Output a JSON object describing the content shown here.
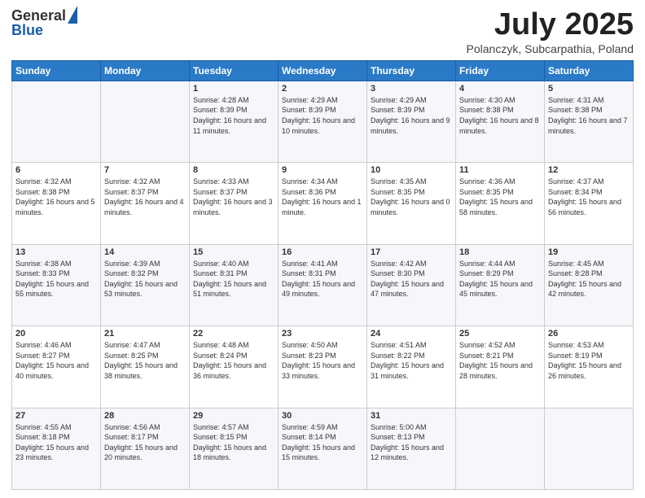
{
  "logo": {
    "general": "General",
    "blue": "Blue"
  },
  "header": {
    "month": "July 2025",
    "location": "Polanczyk, Subcarpathia, Poland"
  },
  "weekdays": [
    "Sunday",
    "Monday",
    "Tuesday",
    "Wednesday",
    "Thursday",
    "Friday",
    "Saturday"
  ],
  "weeks": [
    [
      {
        "day": "",
        "info": ""
      },
      {
        "day": "",
        "info": ""
      },
      {
        "day": "1",
        "info": "Sunrise: 4:28 AM\nSunset: 8:39 PM\nDaylight: 16 hours and 11 minutes."
      },
      {
        "day": "2",
        "info": "Sunrise: 4:29 AM\nSunset: 8:39 PM\nDaylight: 16 hours and 10 minutes."
      },
      {
        "day": "3",
        "info": "Sunrise: 4:29 AM\nSunset: 8:39 PM\nDaylight: 16 hours and 9 minutes."
      },
      {
        "day": "4",
        "info": "Sunrise: 4:30 AM\nSunset: 8:38 PM\nDaylight: 16 hours and 8 minutes."
      },
      {
        "day": "5",
        "info": "Sunrise: 4:31 AM\nSunset: 8:38 PM\nDaylight: 16 hours and 7 minutes."
      }
    ],
    [
      {
        "day": "6",
        "info": "Sunrise: 4:32 AM\nSunset: 8:38 PM\nDaylight: 16 hours and 5 minutes."
      },
      {
        "day": "7",
        "info": "Sunrise: 4:32 AM\nSunset: 8:37 PM\nDaylight: 16 hours and 4 minutes."
      },
      {
        "day": "8",
        "info": "Sunrise: 4:33 AM\nSunset: 8:37 PM\nDaylight: 16 hours and 3 minutes."
      },
      {
        "day": "9",
        "info": "Sunrise: 4:34 AM\nSunset: 8:36 PM\nDaylight: 16 hours and 1 minute."
      },
      {
        "day": "10",
        "info": "Sunrise: 4:35 AM\nSunset: 8:35 PM\nDaylight: 16 hours and 0 minutes."
      },
      {
        "day": "11",
        "info": "Sunrise: 4:36 AM\nSunset: 8:35 PM\nDaylight: 15 hours and 58 minutes."
      },
      {
        "day": "12",
        "info": "Sunrise: 4:37 AM\nSunset: 8:34 PM\nDaylight: 15 hours and 56 minutes."
      }
    ],
    [
      {
        "day": "13",
        "info": "Sunrise: 4:38 AM\nSunset: 8:33 PM\nDaylight: 15 hours and 55 minutes."
      },
      {
        "day": "14",
        "info": "Sunrise: 4:39 AM\nSunset: 8:32 PM\nDaylight: 15 hours and 53 minutes."
      },
      {
        "day": "15",
        "info": "Sunrise: 4:40 AM\nSunset: 8:31 PM\nDaylight: 15 hours and 51 minutes."
      },
      {
        "day": "16",
        "info": "Sunrise: 4:41 AM\nSunset: 8:31 PM\nDaylight: 15 hours and 49 minutes."
      },
      {
        "day": "17",
        "info": "Sunrise: 4:42 AM\nSunset: 8:30 PM\nDaylight: 15 hours and 47 minutes."
      },
      {
        "day": "18",
        "info": "Sunrise: 4:44 AM\nSunset: 8:29 PM\nDaylight: 15 hours and 45 minutes."
      },
      {
        "day": "19",
        "info": "Sunrise: 4:45 AM\nSunset: 8:28 PM\nDaylight: 15 hours and 42 minutes."
      }
    ],
    [
      {
        "day": "20",
        "info": "Sunrise: 4:46 AM\nSunset: 8:27 PM\nDaylight: 15 hours and 40 minutes."
      },
      {
        "day": "21",
        "info": "Sunrise: 4:47 AM\nSunset: 8:25 PM\nDaylight: 15 hours and 38 minutes."
      },
      {
        "day": "22",
        "info": "Sunrise: 4:48 AM\nSunset: 8:24 PM\nDaylight: 15 hours and 36 minutes."
      },
      {
        "day": "23",
        "info": "Sunrise: 4:50 AM\nSunset: 8:23 PM\nDaylight: 15 hours and 33 minutes."
      },
      {
        "day": "24",
        "info": "Sunrise: 4:51 AM\nSunset: 8:22 PM\nDaylight: 15 hours and 31 minutes."
      },
      {
        "day": "25",
        "info": "Sunrise: 4:52 AM\nSunset: 8:21 PM\nDaylight: 15 hours and 28 minutes."
      },
      {
        "day": "26",
        "info": "Sunrise: 4:53 AM\nSunset: 8:19 PM\nDaylight: 15 hours and 26 minutes."
      }
    ],
    [
      {
        "day": "27",
        "info": "Sunrise: 4:55 AM\nSunset: 8:18 PM\nDaylight: 15 hours and 23 minutes."
      },
      {
        "day": "28",
        "info": "Sunrise: 4:56 AM\nSunset: 8:17 PM\nDaylight: 15 hours and 20 minutes."
      },
      {
        "day": "29",
        "info": "Sunrise: 4:57 AM\nSunset: 8:15 PM\nDaylight: 15 hours and 18 minutes."
      },
      {
        "day": "30",
        "info": "Sunrise: 4:59 AM\nSunset: 8:14 PM\nDaylight: 15 hours and 15 minutes."
      },
      {
        "day": "31",
        "info": "Sunrise: 5:00 AM\nSunset: 8:13 PM\nDaylight: 15 hours and 12 minutes."
      },
      {
        "day": "",
        "info": ""
      },
      {
        "day": "",
        "info": ""
      }
    ]
  ]
}
